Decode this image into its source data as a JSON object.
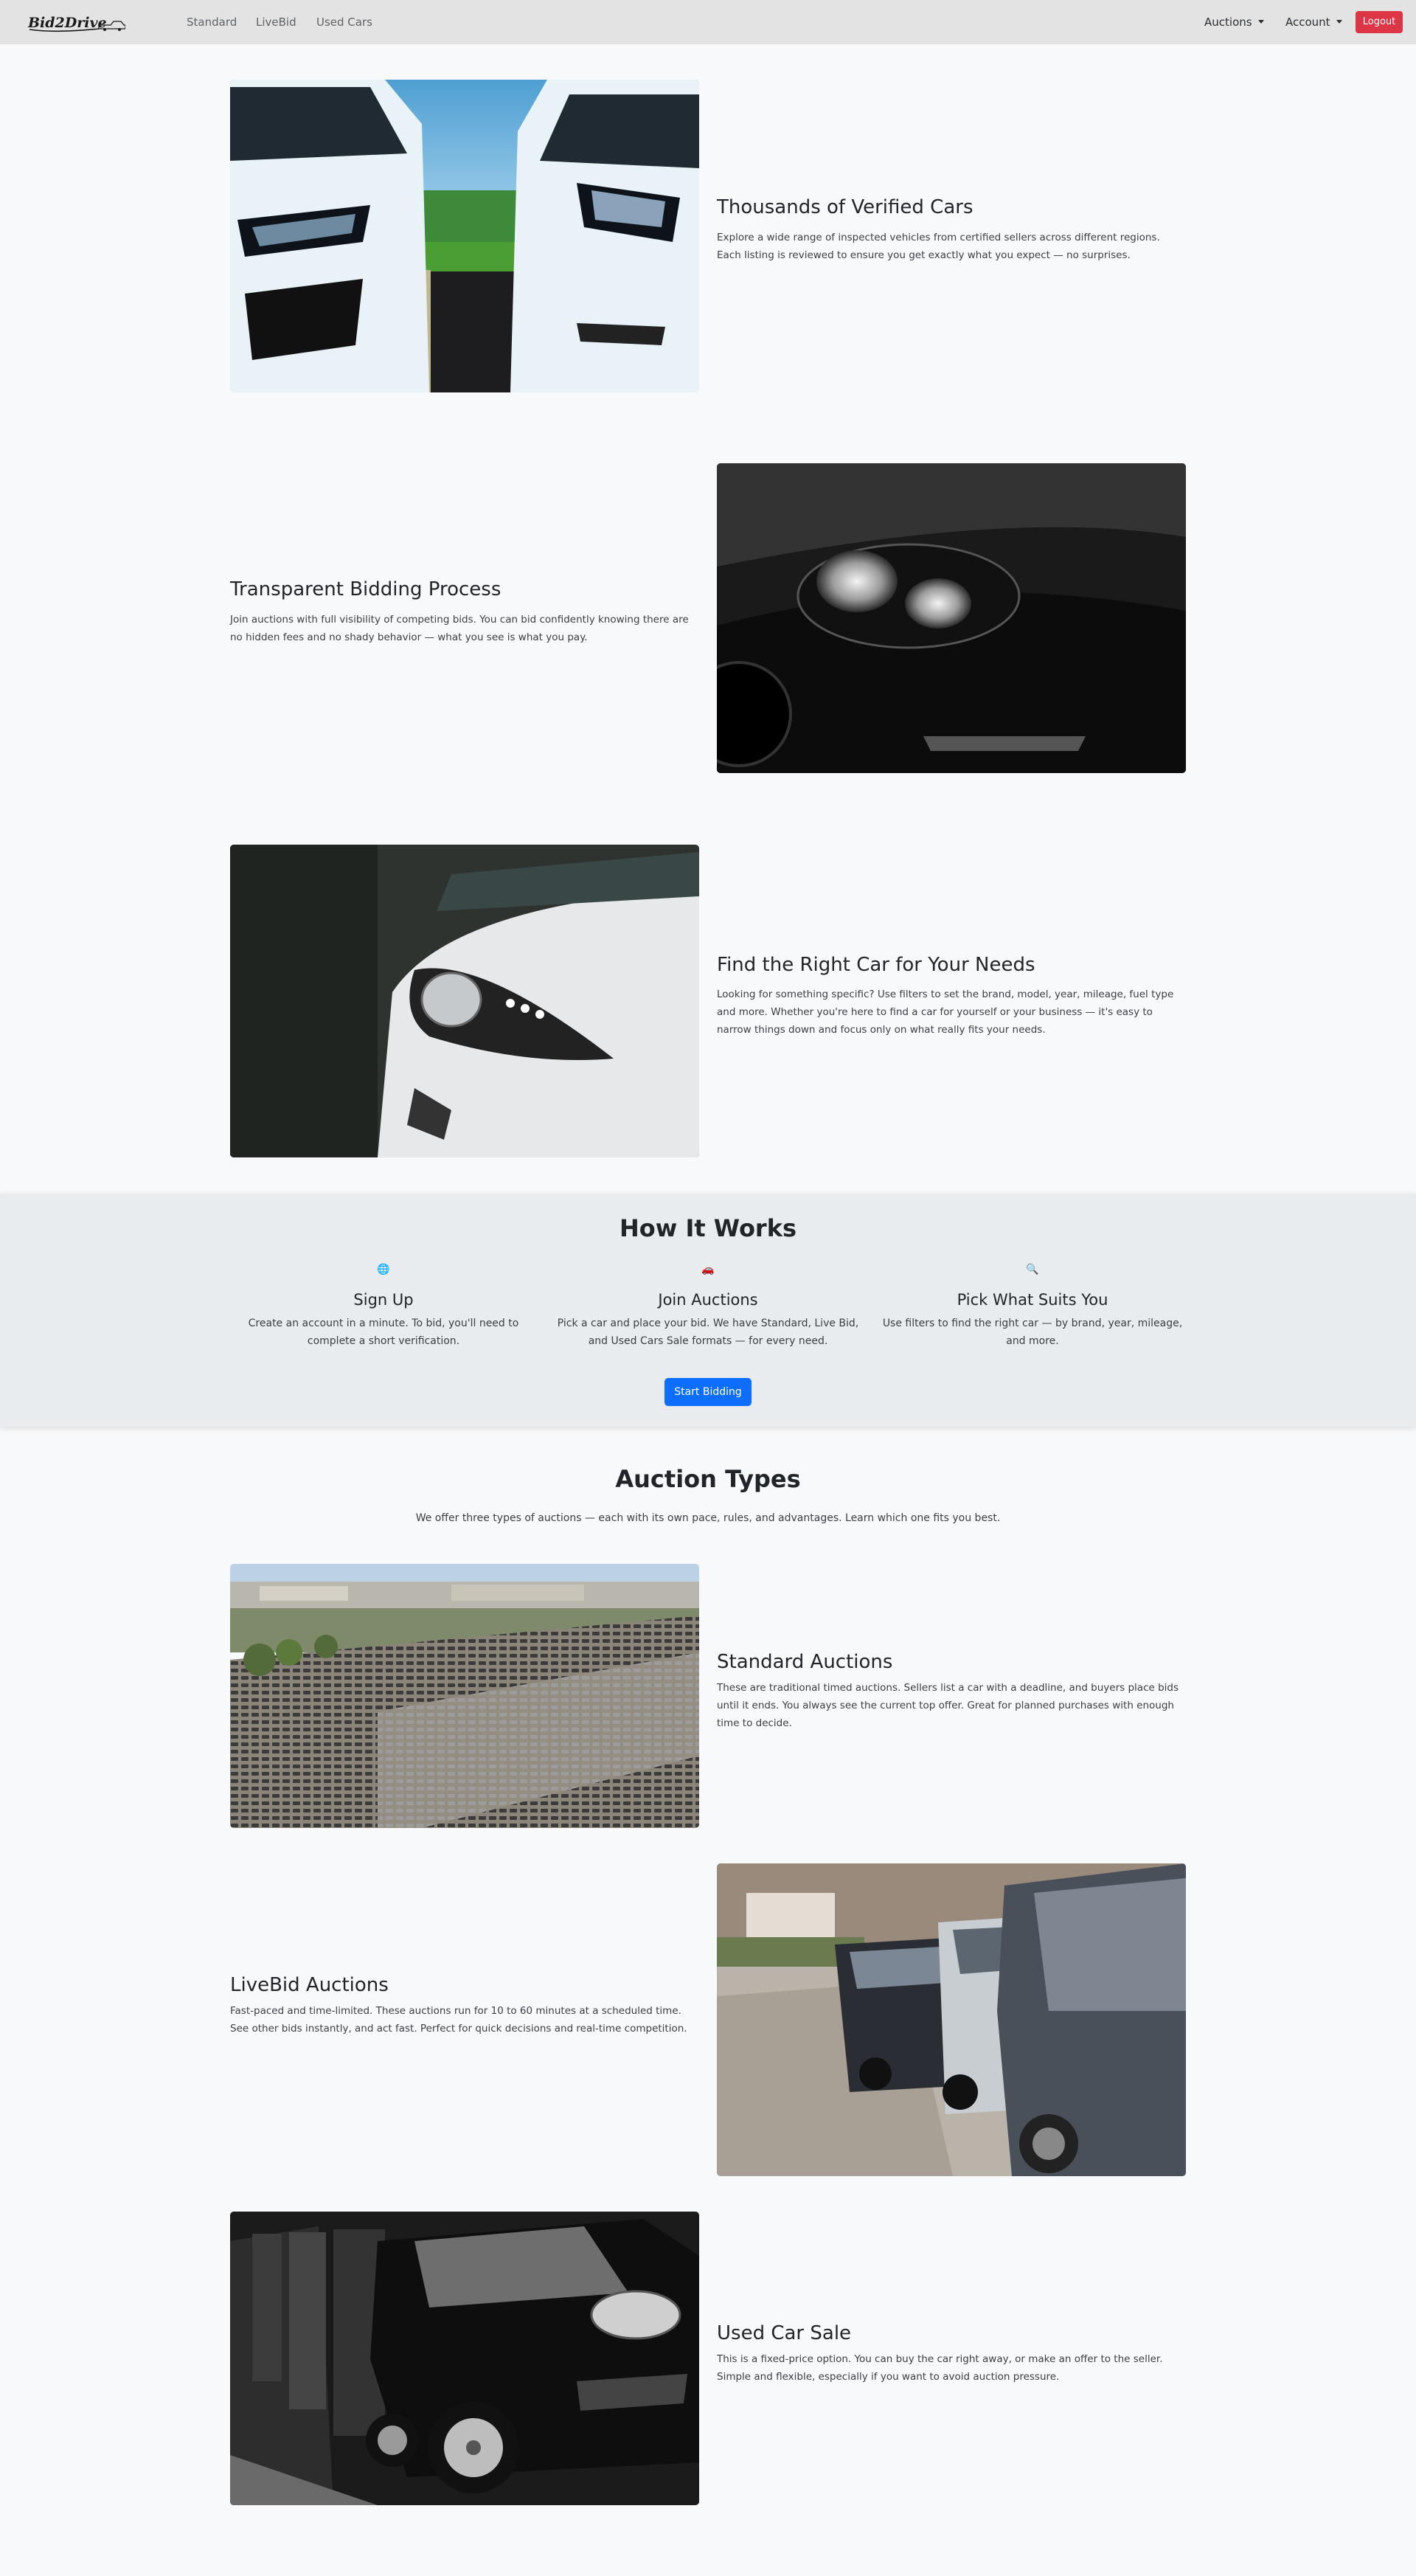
{
  "nav": {
    "brand": "Bid2Drive",
    "links": [
      "Standard",
      "LiveBid",
      "Used Cars"
    ],
    "auctions": "Auctions",
    "account": "Account",
    "logout": "Logout"
  },
  "features": [
    {
      "title": "Thousands of Verified Cars",
      "text": "Explore a wide range of inspected vehicles from certified sellers across different regions. Each listing is reviewed to ensure you get exactly what you expect — no surprises."
    },
    {
      "title": "Transparent Bidding Process",
      "text": "Join auctions with full visibility of competing bids. You can bid confidently knowing there are no hidden fees and no shady behavior — what you see is what you pay."
    },
    {
      "title": "Find the Right Car for Your Needs",
      "text": "Looking for something specific? Use filters to set the brand, model, year, mileage, fuel type and more. Whether you're here to find a car for yourself or your business — it's easy to narrow things down and focus only on what really fits your needs."
    }
  ],
  "how_it_works": {
    "title": "How It Works",
    "steps": [
      {
        "icon": "globe-icon",
        "title": "Sign Up",
        "text": "Create an account in a minute. To bid, you'll need to complete a short verification."
      },
      {
        "icon": "car-icon",
        "title": "Join Auctions",
        "text": "Pick a car and place your bid. We have Standard, Live Bid, and Used Cars Sale formats — for every need."
      },
      {
        "icon": "magnifier-icon",
        "title": "Pick What Suits You",
        "text": "Use filters to find the right car — by brand, year, mileage, and more."
      }
    ],
    "button": "Start Bidding"
  },
  "auction_types": {
    "title": "Auction Types",
    "subtitle": "We offer three types of auctions — each with its own pace, rules, and advantages. Learn which one fits you best.",
    "items": [
      {
        "title": "Standard Auctions",
        "text": "These are traditional timed auctions. Sellers list a car with a deadline, and buyers place bids until it ends. You always see the current top offer. Great for planned purchases with enough time to decide."
      },
      {
        "title": "LiveBid Auctions",
        "text": "Fast-paced and time-limited. These auctions run for 10 to 60 minutes at a scheduled time. See other bids instantly, and act fast. Perfect for quick decisions and real-time competition."
      },
      {
        "title": "Used Car Sale",
        "text": "This is a fixed-price option. You can buy the car right away, or make an offer to the seller. Simple and flexible, especially if you want to avoid auction pressure."
      }
    ]
  },
  "colors": {
    "navbar": "#e3e3e3",
    "logout": "#dc3545",
    "primary": "#0d6efd",
    "page_bg": "#f8f9fa",
    "section_bg": "#e9ecef"
  }
}
